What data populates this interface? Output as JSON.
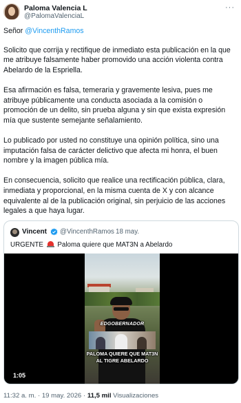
{
  "author": {
    "name": "Paloma Valencia L",
    "handle": "@PalomaValenciaL"
  },
  "tweet": {
    "salutation": "Señor",
    "mention": "@VincenthRamos",
    "paragraphs": [
      "Solicito que corrija y rectifique de inmediato esta publicación en la que me atribuye falsamente haber promovido una acción violenta contra Abelardo de la Espriella.",
      "Esa afirmación es falsa, temeraria y gravemente lesiva, pues me atribuye públicamente una conducta asociada a la comisión o promoción de un delito, sin prueba alguna y sin que exista expresión mía que sustente semejante señalamiento.",
      "Lo publicado por usted no constituye una opinión política, sino una imputación falsa de carácter delictivo que afecta mi honra, el buen nombre y la imagen pública mía.",
      "En consecuencia, solicito que realice una rectificación pública, clara, inmediata y proporcional, en la misma cuenta de X y con alcance equivalente al de la publicación original, sin perjuicio de las acciones legales a que haya lugar."
    ]
  },
  "quote": {
    "author_name": "Vincent",
    "verified_icon": "verified-badge-icon",
    "handle": "@VincenthRamos",
    "separator": "·",
    "date": "18 may.",
    "text_before": "URGENTE",
    "siren_icon": "police-light-icon",
    "text_after": "Paloma quiere que MAT3N a Abelardo",
    "video": {
      "caption_top": "EDGOBERNADOR",
      "caption_bottom_line1": "PALOMA QUIERE QUE MAT3N",
      "caption_bottom_line2": "AL TIGRE ABELARDO",
      "duration": "1:05"
    }
  },
  "meta": {
    "time": "11:32 a. m.",
    "dot": "·",
    "date": "19 may. 2026",
    "dot2": "·",
    "views_count": "11,5 mil",
    "views_label": "Visualizaciones"
  },
  "colors": {
    "link": "#1d9bf0",
    "text": "#0f1419",
    "secondary": "#536471",
    "border": "#cfd9de"
  }
}
